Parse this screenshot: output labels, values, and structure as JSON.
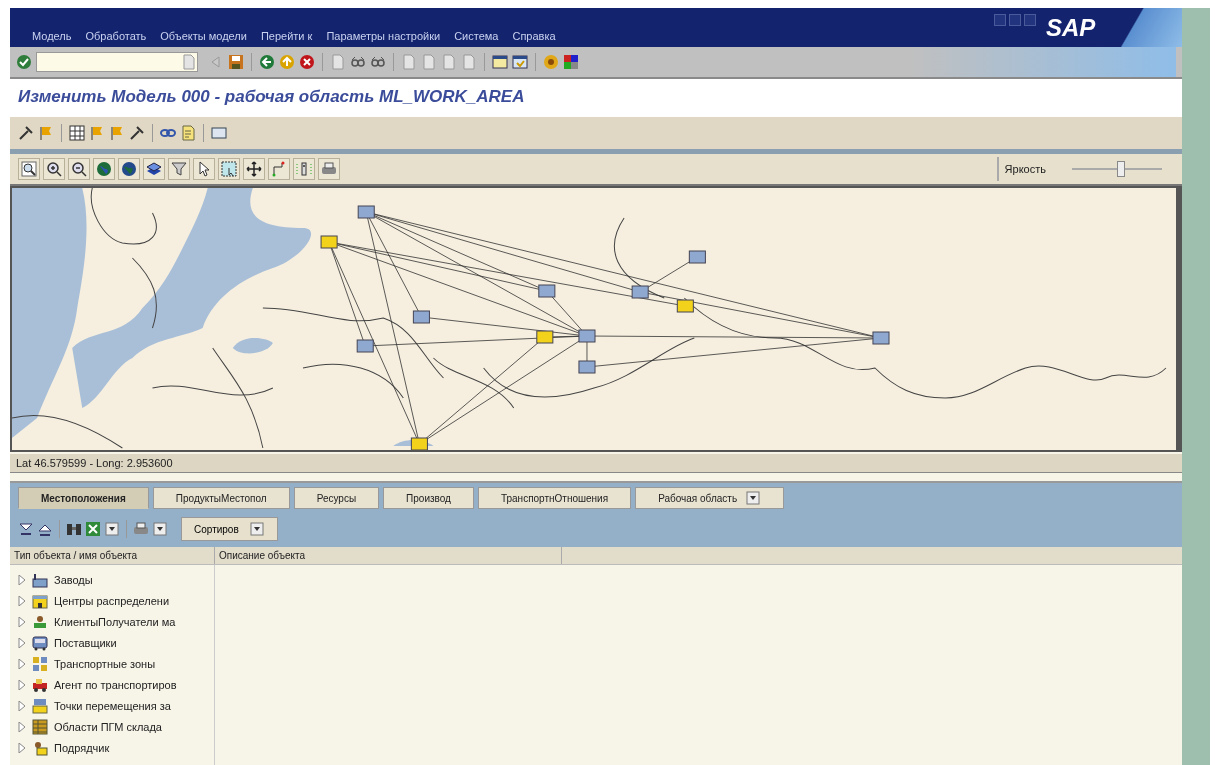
{
  "window": {
    "menu": [
      "Модель",
      "Обработать",
      "Объекты модели",
      "Перейти к",
      "Параметры настройки",
      "Система",
      "Справка"
    ],
    "logo": "SAP"
  },
  "title": "Изменить Модель 000 - рабочая область ML_WORK_AREA",
  "map": {
    "kind": "picture",
    "brightness": {
      "label": "Яркость",
      "level": 0.55
    },
    "status": "Lat 46.579599 - Long: 2.953600"
  },
  "tabs": [
    {
      "label": "Местоположения",
      "selected": true
    },
    {
      "label": "ПродуктыМестопол",
      "selected": false
    },
    {
      "label": "Ресурсы",
      "selected": false
    },
    {
      "label": "Производ",
      "selected": false
    },
    {
      "label": "ТранспортнОтношения",
      "selected": false
    },
    {
      "label": "Рабочая область",
      "selected": false
    }
  ],
  "tree_toolbar": {
    "sort_button": "Сортиров"
  },
  "tree": {
    "columns": [
      "Тип объекта / имя объекта",
      "Описание объекта"
    ],
    "items": [
      {
        "label": "Заводы",
        "expanded": false
      },
      {
        "label": "Центры распределени",
        "expanded": false
      },
      {
        "label": "КлиентыПолучатели ма",
        "expanded": false
      },
      {
        "label": "Поставщики",
        "expanded": false
      },
      {
        "label": "Транспортные зоны",
        "expanded": false
      },
      {
        "label": "Агент по транспортиров",
        "expanded": false
      },
      {
        "label": "Точки перемещения за",
        "expanded": false
      },
      {
        "label": "Области ПГМ склада",
        "expanded": false
      },
      {
        "label": "Подрядчик",
        "expanded": false
      }
    ]
  }
}
